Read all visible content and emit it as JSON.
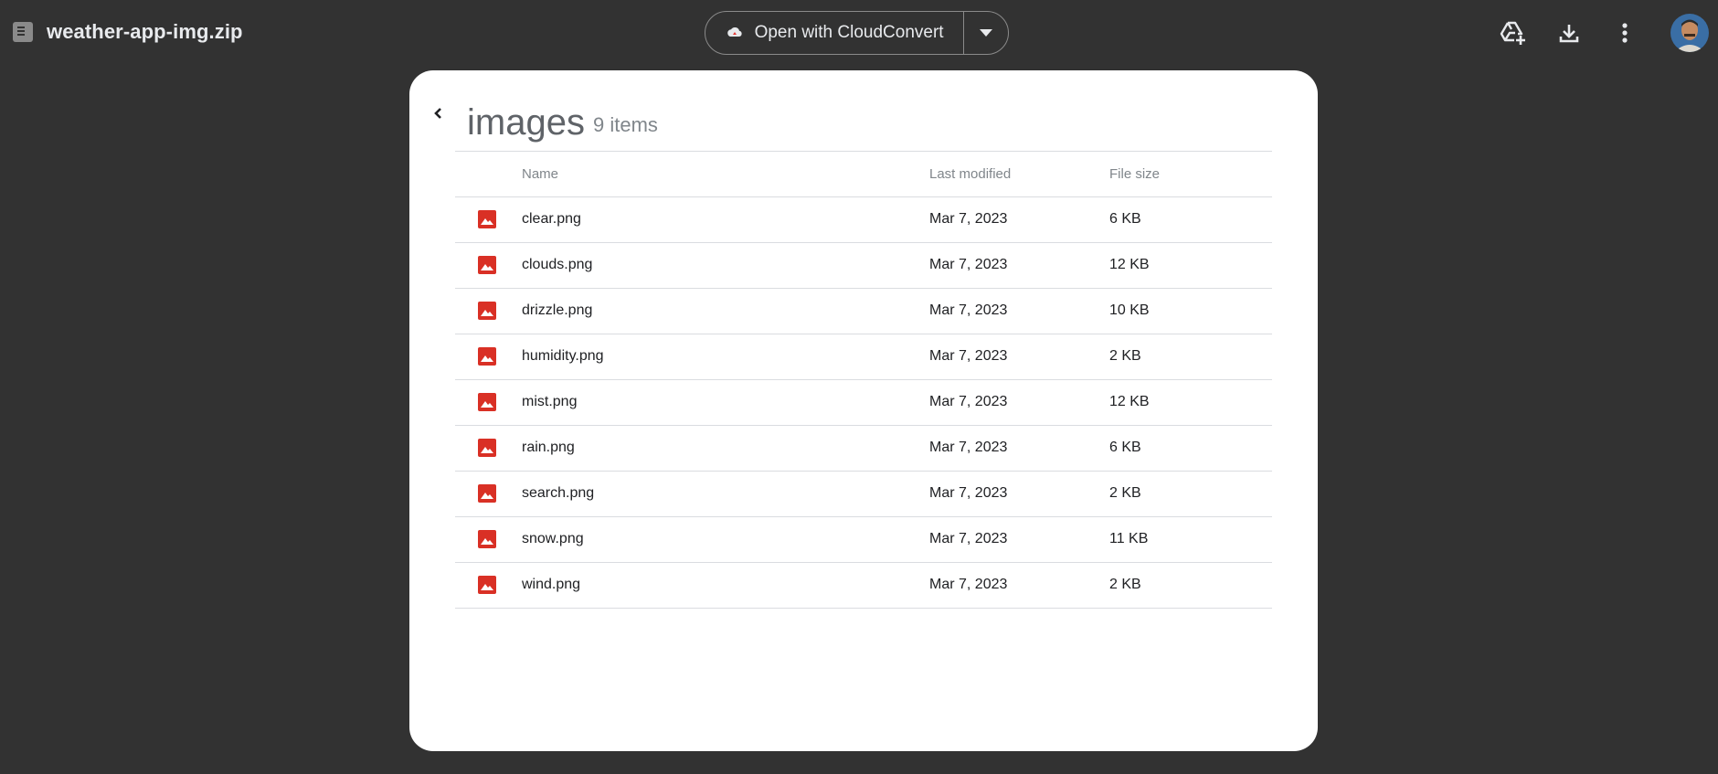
{
  "header": {
    "file_name": "weather-app-img.zip",
    "open_with_label": "Open with CloudConvert",
    "icons": {
      "file": "zip-file-icon",
      "cloudconvert": "cloudconvert-icon",
      "more_options": "chevron-down-icon",
      "add_to_drive": "add-to-drive-icon",
      "download": "download-icon",
      "menu": "more-vert-icon"
    }
  },
  "folder": {
    "title": "images",
    "count": "9 items"
  },
  "table": {
    "columns": {
      "name": "Name",
      "modified": "Last modified",
      "size": "File size"
    },
    "rows": [
      {
        "name": "clear.png",
        "modified": "Mar 7, 2023",
        "size": "6 KB"
      },
      {
        "name": "clouds.png",
        "modified": "Mar 7, 2023",
        "size": "12 KB"
      },
      {
        "name": "drizzle.png",
        "modified": "Mar 7, 2023",
        "size": "10 KB"
      },
      {
        "name": "humidity.png",
        "modified": "Mar 7, 2023",
        "size": "2 KB"
      },
      {
        "name": "mist.png",
        "modified": "Mar 7, 2023",
        "size": "12 KB"
      },
      {
        "name": "rain.png",
        "modified": "Mar 7, 2023",
        "size": "6 KB"
      },
      {
        "name": "search.png",
        "modified": "Mar 7, 2023",
        "size": "2 KB"
      },
      {
        "name": "snow.png",
        "modified": "Mar 7, 2023",
        "size": "11 KB"
      },
      {
        "name": "wind.png",
        "modified": "Mar 7, 2023",
        "size": "2 KB"
      }
    ]
  },
  "colors": {
    "background": "#323232",
    "panel": "#ffffff",
    "image_icon": "#d93025",
    "divider": "#dadce0"
  }
}
